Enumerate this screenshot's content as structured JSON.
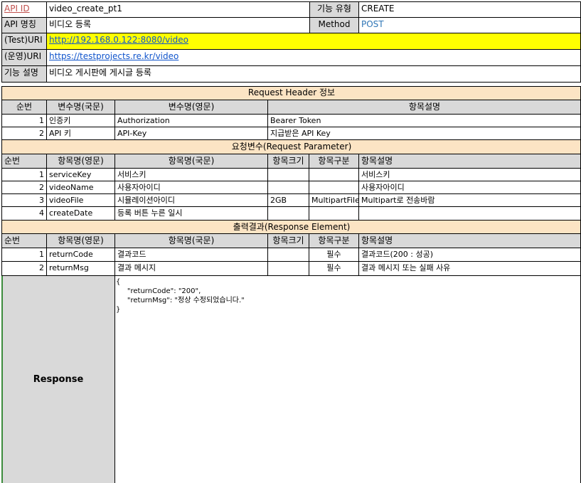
{
  "api_info": {
    "id_label": "API ID",
    "id_value": "video_create_pt1",
    "func_type_label": "기능 유형",
    "func_type_value": "CREATE",
    "name_label": "API 명칭",
    "name_value": "비디오 등록",
    "method_label": "Method",
    "method_value": "POST",
    "test_uri_label": "(Test)URI",
    "test_uri_value": "http://192.168.0.122:8080/video",
    "prod_uri_label": "(운영)URI",
    "prod_uri_value": "https://testprojects.re.kr/video",
    "desc_label": "기능 설명",
    "desc_value": "비디오 게시판에 게시글 등록"
  },
  "request_header": {
    "title": "Request Header 정보",
    "columns": [
      "순번",
      "변수명(국문)",
      "변수명(영문)",
      "항목설명"
    ],
    "rows": [
      {
        "no": "1",
        "kor": "인증키",
        "eng": "Authorization",
        "desc": "Bearer Token"
      },
      {
        "no": "2",
        "kor": "API 키",
        "eng": "API-Key",
        "desc": "지급받은 API Key"
      }
    ]
  },
  "request_param": {
    "title": "요청변수(Request Parameter)",
    "columns": [
      "순번",
      "항목명(영문)",
      "항목명(국문)",
      "항목크기",
      "항목구분",
      "항목설명"
    ],
    "rows": [
      {
        "no": "1",
        "eng": "serviceKey",
        "kor": "서비스키",
        "size": "",
        "type": "",
        "desc": "서비스키"
      },
      {
        "no": "2",
        "eng": "videoName",
        "kor": "사용자아이디",
        "size": "",
        "type": "",
        "desc": "사용자아이디"
      },
      {
        "no": "3",
        "eng": "videoFile",
        "kor": "시뮬레이션아이디",
        "size": "2GB",
        "type": "MultipartFile",
        "desc": "Multipart로 전송바람"
      },
      {
        "no": "4",
        "eng": "createDate",
        "kor": "등록 버튼 누른 일시",
        "size": "",
        "type": "",
        "desc": ""
      }
    ]
  },
  "response_element": {
    "title": "출력결과(Response Element)",
    "columns": [
      "순번",
      "항목명(영문)",
      "항목명(국문)",
      "항목크기",
      "항목구분",
      "항목설명"
    ],
    "rows": [
      {
        "no": "1",
        "eng": "returnCode",
        "kor": "결과코드",
        "size": "",
        "type": "필수",
        "desc": "결과코드(200 : 성공)"
      },
      {
        "no": "2",
        "eng": "returnMsg",
        "kor": "결과 메시지",
        "size": "",
        "type": "필수",
        "desc": "결과 메시지 또는 실패 사유"
      }
    ]
  },
  "response": {
    "label": "Response",
    "body_lines": [
      "{",
      "     \"returnCode\": \"200\",",
      "     \"returnMsg\": \"정상 수정되었습니다.\"",
      "}"
    ]
  }
}
